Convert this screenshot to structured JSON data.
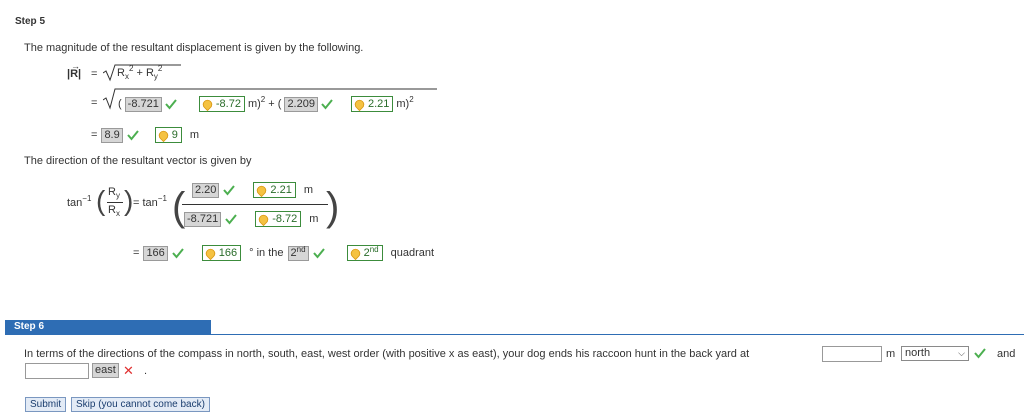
{
  "step5": {
    "label": "Step 5",
    "intro": "The magnitude of the resultant displacement is given by the following.",
    "mag_symbol": "R",
    "eq": "=",
    "rx": "R",
    "rx_sub": "x",
    "ry": "R",
    "ry_sub": "y",
    "sq": "2",
    "plus": "+",
    "line2": {
      "open": "(",
      "ans1": "-8.721",
      "key1": "-8.72",
      "m_sq_plus_open": " m)",
      "sq": "2",
      "plus_open": " + (",
      "ans2": "2.209",
      "key2": "2.21",
      "close": " m)",
      "sq2": "2"
    },
    "line3": {
      "ans": "8.9",
      "key": "9",
      "unit": "m"
    },
    "direction_intro": "The direction of the resultant vector is given by",
    "tan_label": "tan",
    "tan_sup": "−1",
    "frac_num": "R",
    "frac_num_sub": "y",
    "frac_den": "R",
    "frac_den_sub": "x",
    "eq_tan": "= tan",
    "num_ans": "2.20",
    "num_key": "2.21",
    "num_unit": "m",
    "den_ans": "-8.721",
    "den_key": "-8.72",
    "den_unit": "m",
    "angle_ans": "166",
    "angle_key": "166",
    "angle_text": "° in the",
    "quad_ans": "2",
    "quad_ans_sup": "nd",
    "quad_key": "2",
    "quad_key_sup": "nd",
    "quad_word": "quadrant"
  },
  "step6": {
    "label": "Step 6",
    "question": "In terms of the directions of the compass in north, south, east, west order (with positive x as east), your dog ends his raccoon hunt in the back yard at",
    "input1_value": "",
    "unit1": "m",
    "select1_value": "north",
    "and_text": "and",
    "input2_value": "",
    "select2_value": "east",
    "period": "."
  },
  "buttons": {
    "submit": "Submit",
    "skip": "Skip (you cannot come back)"
  },
  "colors": {
    "step_bar": "#2e6db4",
    "correct_green": "#4caf50",
    "wrong_red": "#e03030"
  }
}
